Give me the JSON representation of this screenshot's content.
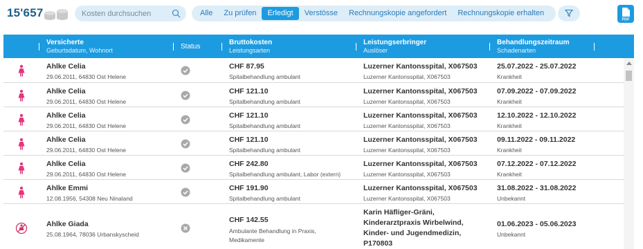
{
  "header": {
    "count": "15'657",
    "search_placeholder": "Kosten durchsuchen",
    "filters": [
      "Alle",
      "Zu prüfen",
      "Erledigt",
      "Verstösse",
      "Rechnungskopie angefordert",
      "Rechnungskopie erhalten"
    ],
    "active_filter": "Erledigt",
    "pdf_label": "PDF"
  },
  "columns": [
    {
      "title": "Versicherte",
      "sub": "Geburtsdatum, Wohnort"
    },
    {
      "title": "Status",
      "sub": ""
    },
    {
      "title": "Bruttokosten",
      "sub": "Leistungsarten"
    },
    {
      "title": "Leistungserbringer",
      "sub": "Auslöser"
    },
    {
      "title": "Behandlungszeitraum",
      "sub": "Schadenarten"
    }
  ],
  "rows": [
    {
      "name": "Ahlke Celia",
      "birth": "29.06.2011, 64830 Ost Helene",
      "status": "check",
      "cost": "CHF 87.95",
      "service": "Spitalbehandlung ambulant",
      "provider": "Luzerner Kantonsspital, X067503",
      "trigger": "Luzerner Kantonsspital, X067503",
      "period": "25.07.2022 - 25.07.2022",
      "damage": "Krankheit"
    },
    {
      "name": "Ahlke Celia",
      "birth": "29.06.2011, 64830 Ost Helene",
      "status": "check",
      "cost": "CHF 121.10",
      "service": "Spitalbehandlung ambulant",
      "provider": "Luzerner Kantonsspital, X067503",
      "trigger": "Luzerner Kantonsspital, X067503",
      "period": "07.09.2022 - 07.09.2022",
      "damage": "Krankheit"
    },
    {
      "name": "Ahlke Celia",
      "birth": "29.06.2011, 64830 Ost Helene",
      "status": "check",
      "cost": "CHF 121.10",
      "service": "Spitalbehandlung ambulant",
      "provider": "Luzerner Kantonsspital, X067503",
      "trigger": "Luzerner Kantonsspital, X067503",
      "period": "12.10.2022 - 12.10.2022",
      "damage": "Krankheit"
    },
    {
      "name": "Ahlke Celia",
      "birth": "29.06.2011, 64830 Ost Helene",
      "status": "check",
      "cost": "CHF 121.10",
      "service": "Spitalbehandlung ambulant",
      "provider": "Luzerner Kantonsspital, X067503",
      "trigger": "Luzerner Kantonsspital, X067503",
      "period": "09.11.2022 - 09.11.2022",
      "damage": "Krankheit"
    },
    {
      "name": "Ahlke Celia",
      "birth": "29.06.2011, 64830 Ost Helene",
      "status": "check",
      "cost": "CHF 242.80",
      "service": "Spitalbehandlung ambulant, Labor (extern)",
      "provider": "Luzerner Kantonsspital, X067503",
      "trigger": "Luzerner Kantonsspital, X067503",
      "period": "07.12.2022 - 07.12.2022",
      "damage": "Krankheit"
    },
    {
      "name": "Ahlke Emmi",
      "birth": "12.08.1956, 54308 Neu Ninaland",
      "status": "check",
      "cost": "CHF 191.90",
      "service": "Spitalbehandlung ambulant",
      "provider": "Luzerner Kantonsspital, X067503",
      "trigger": "Luzerner Kantonsspital, X067503",
      "period": "31.08.2022 - 31.08.2022",
      "damage": "Unbekannt"
    },
    {
      "name": "Ahlke Giada",
      "birth": "25.08.1964, 78036 Urbanskyscheid",
      "status": "cross",
      "cost": "CHF 142.55",
      "service": "Ambulante Behandlung in Praxis, Medikamente",
      "provider": "Karin Häfliger-Gräni, Kinderarztpraxis Wirbelwind, Kinder- und Jugendmedizin, P170803",
      "trigger": "",
      "period": "01.06.2023 - 05.06.2023",
      "damage": "Unbekannt"
    }
  ]
}
